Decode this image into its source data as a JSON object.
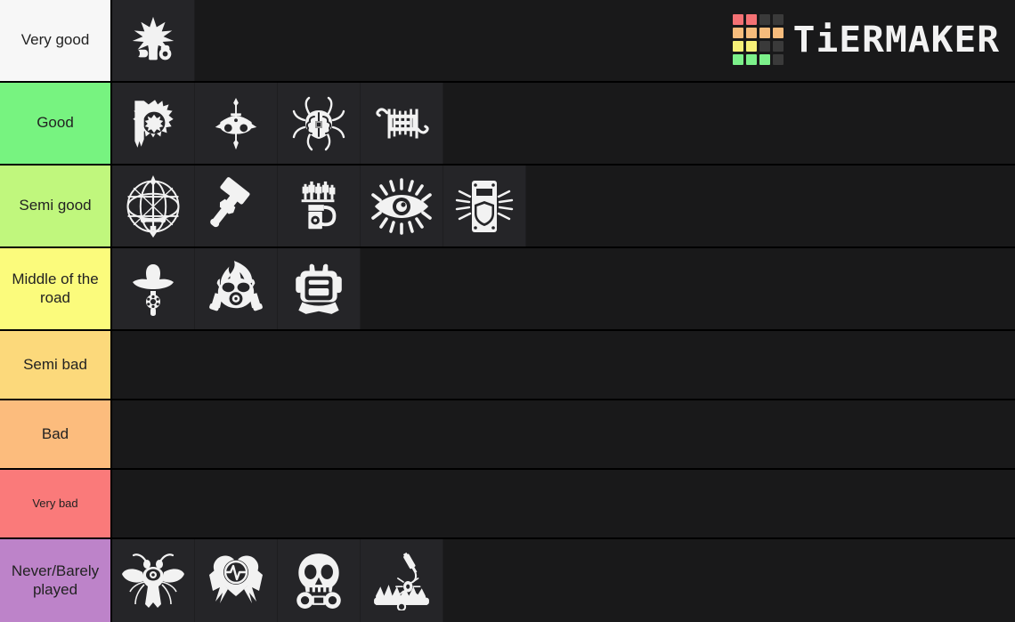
{
  "app": {
    "name": "TierMaker",
    "brand_word": "TiERMAKER"
  },
  "brand": {
    "grid_colors": [
      "#f47174",
      "#f47174",
      "#3a3a3a",
      "#3a3a3a",
      "#f7bc7c",
      "#f7bc7c",
      "#f7bc7c",
      "#f7bc7c",
      "#f6f077",
      "#f6f077",
      "#3a3a3a",
      "#3a3a3a",
      "#7cf08a",
      "#7cf08a",
      "#7cf08a",
      "#3a3a3a"
    ]
  },
  "colors": {
    "background": "#1a1a18",
    "row_background": "#19191a",
    "cell_background": "#252528",
    "divider": "#000000",
    "label_text": "#222222",
    "icon": "#f2f2f2"
  },
  "tiers": [
    {
      "label": "Very good",
      "color": "#f7f7f7",
      "label_size": "normal",
      "items": [
        {
          "name": "firecracker-icon",
          "icon": "firecracker",
          "title": "Firecracker"
        }
      ]
    },
    {
      "label": "Good",
      "color": "#77f380",
      "label_size": "normal",
      "items": [
        {
          "name": "sun-banner-icon",
          "icon": "sun-banner",
          "title": "Sun Banner"
        },
        {
          "name": "sword-mask-icon",
          "icon": "sword-mask",
          "title": "Sword Mask"
        },
        {
          "name": "spider-brain-icon",
          "icon": "spider-brain",
          "title": "Spider Brain"
        },
        {
          "name": "contraption-icon",
          "icon": "contraption",
          "title": "Contraption"
        }
      ]
    },
    {
      "label": "Semi good",
      "color": "#c0f77d",
      "label_size": "normal",
      "items": [
        {
          "name": "sword-orb-icon",
          "icon": "sword-orb",
          "title": "Sword Orb"
        },
        {
          "name": "hammer-icon",
          "icon": "hammer",
          "title": "Hammer"
        },
        {
          "name": "syringe-rack-icon",
          "icon": "syringe-rack",
          "title": "Syringe Rack"
        },
        {
          "name": "radiant-eye-icon",
          "icon": "radiant-eye",
          "title": "Radiant Eye"
        },
        {
          "name": "shield-locker-icon",
          "icon": "shield-locker",
          "title": "Shield Locker"
        }
      ]
    },
    {
      "label": "Middle of the road",
      "color": "#fbfb7c",
      "label_size": "normal",
      "items": [
        {
          "name": "cowboy-revolver-icon",
          "icon": "cowboy-revolver",
          "title": "Cowboy Revolver"
        },
        {
          "name": "flaming-gasmask-icon",
          "icon": "flaming-gasmask",
          "title": "Flaming Gas Mask"
        },
        {
          "name": "backpack-icon",
          "icon": "backpack",
          "title": "Backpack"
        }
      ]
    },
    {
      "label": "Semi bad",
      "color": "#fcd97b",
      "label_size": "normal",
      "items": []
    },
    {
      "label": "Bad",
      "color": "#fcbc7d",
      "label_size": "normal",
      "items": []
    },
    {
      "label": "Very bad",
      "color": "#fa7a7a",
      "label_size": "small",
      "items": []
    },
    {
      "label": "Never/Barely played",
      "color": "#bd83c9",
      "label_size": "normal",
      "items": [
        {
          "name": "eye-fly-icon",
          "icon": "eye-fly",
          "title": "Eye Fly"
        },
        {
          "name": "heart-pulse-icon",
          "icon": "heart-pulse",
          "title": "Heart Pulse"
        },
        {
          "name": "skull-cuffs-icon",
          "icon": "skull-cuffs",
          "title": "Skull Handcuffs"
        },
        {
          "name": "beartrap-icon",
          "icon": "beartrap",
          "title": "Bear Trap"
        }
      ]
    }
  ]
}
